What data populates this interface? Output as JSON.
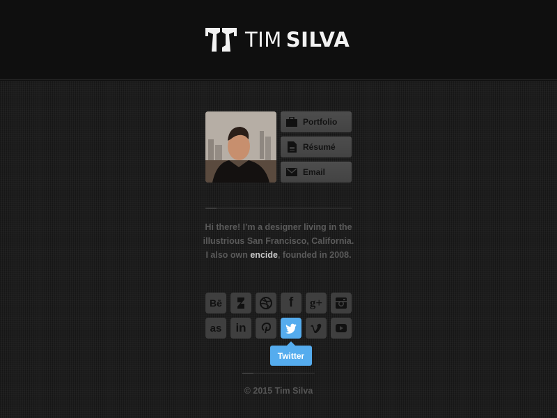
{
  "header": {
    "logo_first": "TIM",
    "logo_last": "SILVA",
    "logo_icon": "ts-monogram-icon"
  },
  "profile": {
    "photo_alt": "Portrait of Tim Silva with San Francisco skyline"
  },
  "nav": [
    {
      "label": "Portfolio",
      "icon": "briefcase-icon"
    },
    {
      "label": "Résumé",
      "icon": "document-icon"
    },
    {
      "label": "Email",
      "icon": "envelope-icon"
    }
  ],
  "bio": {
    "line1": "Hi there!  I’m a designer living in the",
    "line2": "illustrious San Francisco, California.",
    "line3_pre": "I also own ",
    "link": "encide",
    "line3_post": ", founded in 2008."
  },
  "social": [
    {
      "name": "Behance",
      "icon": "behance-icon",
      "glyph": "Bē"
    },
    {
      "name": "DeviantArt",
      "icon": "deviantart-icon"
    },
    {
      "name": "Dribbble",
      "icon": "dribbble-icon"
    },
    {
      "name": "Facebook",
      "icon": "facebook-icon",
      "glyph": "f"
    },
    {
      "name": "Google+",
      "icon": "google-plus-icon",
      "glyph": "g+"
    },
    {
      "name": "Instagram",
      "icon": "instagram-icon"
    },
    {
      "name": "Last.fm",
      "icon": "lastfm-icon",
      "glyph": "as"
    },
    {
      "name": "LinkedIn",
      "icon": "linkedin-icon",
      "glyph": "in"
    },
    {
      "name": "Pinterest",
      "icon": "pinterest-icon",
      "glyph": "P"
    },
    {
      "name": "Twitter",
      "icon": "twitter-icon",
      "active": true
    },
    {
      "name": "Vimeo",
      "icon": "vimeo-icon",
      "glyph": "v"
    },
    {
      "name": "YouTube",
      "icon": "youtube-icon"
    }
  ],
  "tooltip": "Twitter",
  "footer": "© 2015 Tim Silva",
  "colors": {
    "accent_twitter": "#55acee",
    "header_bg": "#0f0f0f",
    "page_bg": "#1d1d1d",
    "button_bg": "#474747"
  }
}
